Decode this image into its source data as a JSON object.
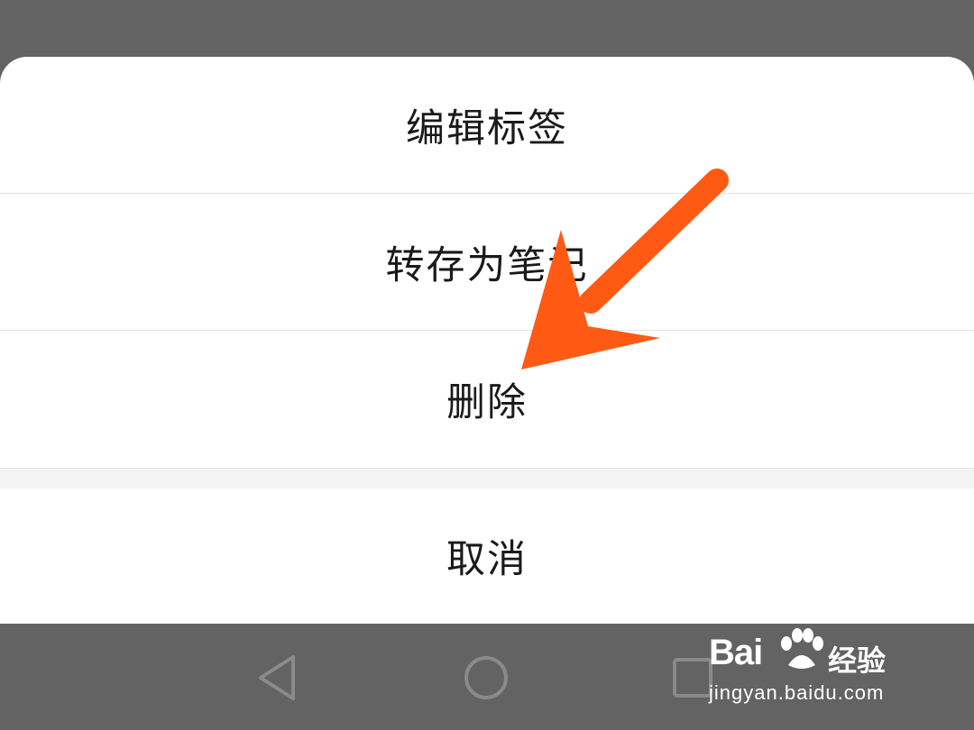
{
  "action_sheet": {
    "items": [
      {
        "label": "编辑标签"
      },
      {
        "label": "转存为笔记"
      },
      {
        "label": "删除"
      }
    ],
    "cancel_label": "取消"
  },
  "annotation": {
    "arrow_color": "#ff5a14"
  },
  "nav_bar": {
    "buttons": [
      "back-icon",
      "home-icon",
      "recent-apps-icon"
    ]
  },
  "watermark": {
    "brand": "Bai",
    "brand_suffix": "经验",
    "url": "jingyan.baidu.com"
  },
  "colors": {
    "overlay": "#636363",
    "sheet": "#ffffff",
    "divider": "#e3e3e3"
  }
}
